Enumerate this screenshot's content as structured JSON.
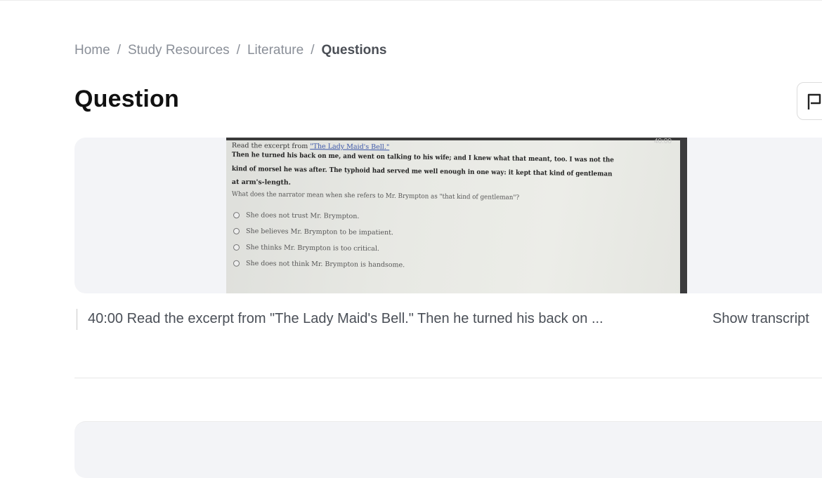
{
  "breadcrumb": {
    "items": [
      "Home",
      "Study Resources",
      "Literature"
    ],
    "separator": "/",
    "current": "Questions"
  },
  "page": {
    "title": "Question"
  },
  "actions": {
    "report_icon": "flag-icon"
  },
  "photo": {
    "timer": "40:00",
    "line1_prefix": "Read the excerpt from",
    "line1_link": "\"The Lady Maid's Bell.\"",
    "line2": "Then he turned his back on me, and went on talking to his wife; and I knew what that meant, too. I was not the",
    "line3": "kind of morsel he was after. The typhoid had served me well enough in one way: it kept that kind of gentleman",
    "line4": "at arm's-length.",
    "question": "What does the narrator mean when she refers to Mr. Brympton as \"that kind of gentleman\"?",
    "options": [
      "She does not trust Mr. Brympton.",
      "She believes Mr. Brympton to be impatient.",
      "She thinks Mr. Brympton is too critical.",
      "She does not think Mr. Brympton is handsome."
    ]
  },
  "transcript": {
    "preview": "40:00 Read the excerpt from \"The Lady Maid's Bell.\" Then he turned his back on ...",
    "toggle_label": "Show transcript"
  }
}
